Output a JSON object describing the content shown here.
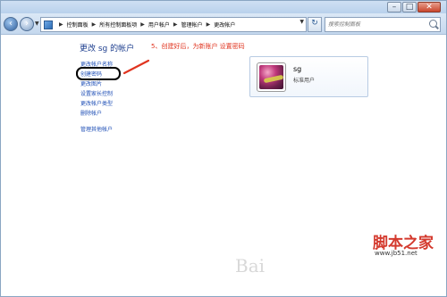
{
  "window": {
    "controls": {
      "minimize": "–",
      "maximize": "□",
      "close": "✕"
    }
  },
  "navbar": {
    "breadcrumbs": [
      "控制面板",
      "所有控制面板项",
      "用户帐户",
      "管理帐户",
      "更改帐户"
    ],
    "search_placeholder": "搜索控制面板"
  },
  "page": {
    "title": "更改 sg 的帐户",
    "annotation": "5、创建好后，为新账户   设置密码"
  },
  "tasks": [
    {
      "label": "更改帐户名称"
    },
    {
      "label": "创建密码"
    },
    {
      "label": "更改图片"
    },
    {
      "label": "设置家长控制"
    },
    {
      "label": "更改帐户类型"
    },
    {
      "label": "删除帐户"
    },
    {
      "label": "管理其他帐户"
    }
  ],
  "account": {
    "name": "sg",
    "type": "标准用户"
  },
  "watermark": "Bai",
  "site_logo": {
    "name": "脚本之家",
    "url": "www.jb51.net"
  },
  "colors": {
    "link": "#1f4fb6",
    "title": "#1e3f8f",
    "annotation": "#e0341f",
    "logo": "#d43a2e"
  }
}
